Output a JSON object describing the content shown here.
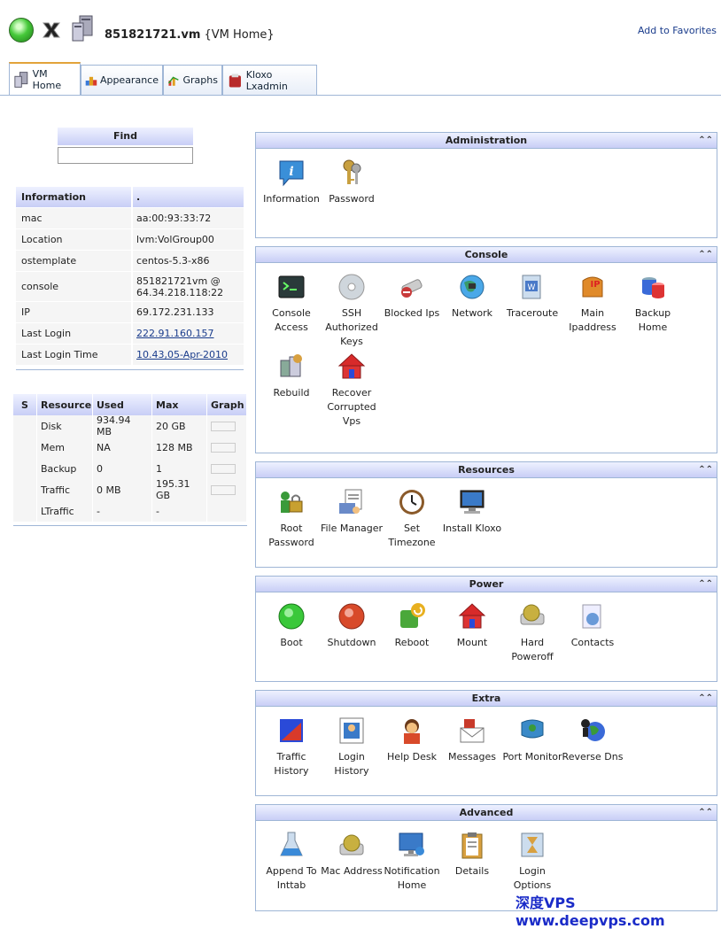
{
  "header": {
    "vm_name": "851821721.vm",
    "vm_suffix": "{VM Home}",
    "favorites": "Add to Favorites"
  },
  "tabs": [
    {
      "label": "VM Home",
      "icon": "vm-server-icon",
      "active": true
    },
    {
      "label": "Appearance",
      "icon": "appearance-icon",
      "active": false
    },
    {
      "label": "Graphs",
      "icon": "graphs-icon",
      "active": false
    },
    {
      "label": "Kloxo Lxadmin",
      "icon": "kloxo-icon",
      "active": false
    }
  ],
  "find": {
    "label": "Find",
    "value": ""
  },
  "info": {
    "header": {
      "name": "Information",
      "value": "."
    },
    "rows": [
      {
        "label": "mac",
        "value": "aa:00:93:33:72",
        "link": false
      },
      {
        "label": "Location",
        "value": "lvm:VolGroup00",
        "link": false
      },
      {
        "label": "ostemplate",
        "value": "centos-5.3-x86",
        "link": false
      },
      {
        "label": "console",
        "value": "851821721vm @ 64.34.218.118:22",
        "link": false
      },
      {
        "label": "IP",
        "value": "69.172.231.133",
        "link": false
      },
      {
        "label": "Last Login",
        "value": "222.91.160.157",
        "link": true
      },
      {
        "label": "Last Login Time",
        "value": "10.43,05-Apr-2010",
        "link": true
      }
    ]
  },
  "resources": {
    "headers": [
      "S",
      "Resource",
      "Used",
      "Max",
      "Graph"
    ],
    "rows": [
      {
        "name": "Disk",
        "used": "934.94 MB",
        "max": "20 GB",
        "graph": 0.05
      },
      {
        "name": "Mem",
        "used": "NA",
        "max": "128 MB",
        "graph": 0
      },
      {
        "name": "Backup",
        "used": "0",
        "max": "1",
        "graph": 0
      },
      {
        "name": "Traffic",
        "used": "0 MB",
        "max": "195.31 GB",
        "graph": 0
      },
      {
        "name": "LTraffic",
        "used": "-",
        "max": "-",
        "graph": null
      }
    ]
  },
  "panels": [
    {
      "title": "Administration",
      "items": [
        {
          "label": "Information",
          "icon": "information-icon",
          "color": "#3a8fd8"
        },
        {
          "label": "Password",
          "icon": "keys-icon",
          "color": "#c8a040"
        }
      ]
    },
    {
      "title": "Console",
      "items": [
        {
          "label": "Console Access",
          "icon": "console-icon",
          "color": "#2a3a3a"
        },
        {
          "label": "SSH Authorized Keys",
          "icon": "cd-icon",
          "color": "#cfd6dc"
        },
        {
          "label": "Blocked Ips",
          "icon": "blocked-usb-icon",
          "color": "#c83a3a"
        },
        {
          "label": "Network",
          "icon": "network-globe-icon",
          "color": "#3a9a6a"
        },
        {
          "label": "Traceroute",
          "icon": "traceroute-icon",
          "color": "#4a7ac8"
        },
        {
          "label": "Main Ipaddress",
          "icon": "ip-icon",
          "color": "#e08a2a"
        },
        {
          "label": "Backup Home",
          "icon": "database-icon",
          "color": "#3a6ad8"
        },
        {
          "label": "Rebuild",
          "icon": "rebuild-icon",
          "color": "#d8a040"
        },
        {
          "label": "Recover Corrupted Vps",
          "icon": "home-icon",
          "color": "#d82a2a"
        }
      ]
    },
    {
      "title": "Resources",
      "items": [
        {
          "label": "Root Password",
          "icon": "lock-user-icon",
          "color": "#c8a030"
        },
        {
          "label": "File Manager",
          "icon": "file-manager-icon",
          "color": "#6a8ac8"
        },
        {
          "label": "Set Timezone",
          "icon": "clock-icon",
          "color": "#8a5a2a"
        },
        {
          "label": "Install Kloxo",
          "icon": "monitor-icon",
          "color": "#3a7ac8"
        }
      ]
    },
    {
      "title": "Power",
      "items": [
        {
          "label": "Boot",
          "icon": "boot-icon",
          "color": "#3ac83a"
        },
        {
          "label": "Shutdown",
          "icon": "shutdown-icon",
          "color": "#d84a2a"
        },
        {
          "label": "Reboot",
          "icon": "reboot-icon",
          "color": "#4aa83a"
        },
        {
          "label": "Mount",
          "icon": "mount-icon",
          "color": "#d82a2a"
        },
        {
          "label": "Hard Poweroff",
          "icon": "hard-disk-icon",
          "color": "#c8b040"
        },
        {
          "label": "Contacts",
          "icon": "contacts-icon",
          "color": "#6a9ad8"
        }
      ]
    },
    {
      "title": "Extra",
      "items": [
        {
          "label": "Traffic History",
          "icon": "traffic-chart-icon",
          "color": "#d83a2a"
        },
        {
          "label": "Login History",
          "icon": "login-history-icon",
          "color": "#3a7ac8"
        },
        {
          "label": "Help Desk",
          "icon": "help-desk-icon",
          "color": "#d84a2a"
        },
        {
          "label": "Messages",
          "icon": "messages-icon",
          "color": "#c83a2a"
        },
        {
          "label": "Port Monitor",
          "icon": "port-monitor-icon",
          "color": "#3a8ac8"
        },
        {
          "label": "Reverse Dns",
          "icon": "reverse-dns-icon",
          "color": "#3a6ad8"
        }
      ]
    },
    {
      "title": "Advanced",
      "items": [
        {
          "label": "Append To Inttab",
          "icon": "flask-icon",
          "color": "#3a8ad8"
        },
        {
          "label": "Mac Address",
          "icon": "mac-disk-icon",
          "color": "#c8b040"
        },
        {
          "label": "Notification Home",
          "icon": "notification-icon",
          "color": "#3a7ac8"
        },
        {
          "label": "Details",
          "icon": "clipboard-icon",
          "color": "#d8a040"
        },
        {
          "label": "Login Options",
          "icon": "hourglass-icon",
          "color": "#d8a040"
        }
      ]
    }
  ],
  "watermark": "深度VPS  www.deepvps.com"
}
